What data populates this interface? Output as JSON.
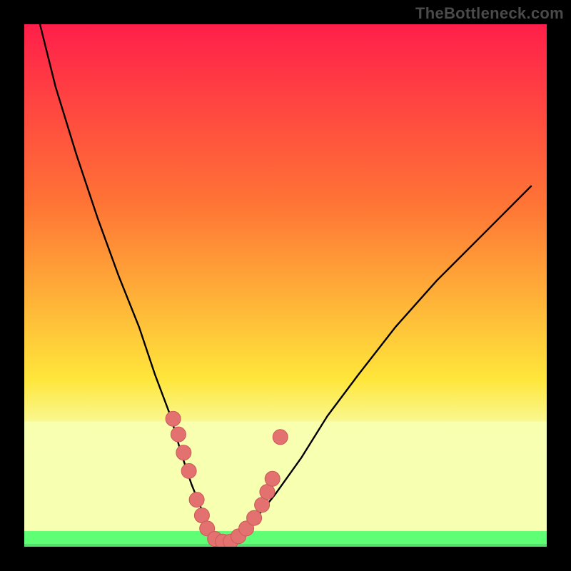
{
  "watermark": {
    "text": "TheBottleneck.com"
  },
  "colors": {
    "frame": "#000000",
    "curve": "#000000",
    "marker_fill": "#e2716f",
    "marker_stroke": "#c95a58",
    "band_top": "#f7ffb0",
    "band_mid": "#5eff74",
    "band_bottom": "#53e06a",
    "grad_top": "#ff1f4a",
    "grad_upper": "#ff7635",
    "grad_mid": "#ffe63b",
    "grad_lower": "#f7ffb0"
  },
  "chart_data": {
    "type": "line",
    "title": "",
    "xlabel": "",
    "ylabel": "",
    "xlim": [
      0,
      100
    ],
    "ylim": [
      0,
      100
    ],
    "series": [
      {
        "name": "bottleneck-curve",
        "x": [
          3,
          6,
          10,
          14,
          18,
          22,
          25,
          28,
          30,
          32,
          34,
          35.5,
          37,
          39,
          41,
          44,
          48,
          53,
          58,
          64,
          71,
          79,
          88,
          97
        ],
        "values": [
          100,
          88,
          75,
          63,
          52,
          42,
          33,
          25,
          18,
          12,
          7,
          3,
          1,
          1,
          2,
          5,
          10,
          17,
          25,
          33,
          42,
          51,
          60,
          69
        ]
      }
    ],
    "markers": {
      "name": "highlighted-points",
      "x": [
        28.5,
        29.5,
        30.5,
        31.5,
        33.0,
        34.0,
        35.0,
        36.5,
        38.0,
        39.5,
        41.0,
        42.5,
        44.0,
        45.5,
        46.5,
        47.5,
        49.0
      ],
      "values": [
        24.5,
        21.5,
        18.0,
        14.5,
        9.0,
        6.0,
        3.5,
        1.5,
        1.0,
        1.0,
        2.0,
        3.5,
        5.5,
        8.0,
        10.5,
        13.0,
        21.0
      ]
    },
    "bands": [
      {
        "name": "pale-band",
        "y0": 18.5,
        "y1": 24.0
      },
      {
        "name": "green-band",
        "y0": 0.0,
        "y1": 3.0
      }
    ]
  }
}
